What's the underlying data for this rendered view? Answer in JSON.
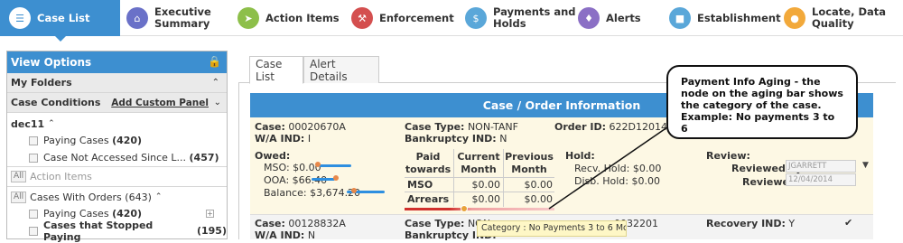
{
  "nav": {
    "items": [
      {
        "label": "Case List",
        "icon": "list-icon",
        "color": "#3d8fd0"
      },
      {
        "label": "Executive\nSummary",
        "icon": "home-icon",
        "color": "#6a71c8"
      },
      {
        "label": "Action Items",
        "icon": "arrow-icon",
        "color": "#8dbf4a"
      },
      {
        "label": "Enforcement",
        "icon": "gavel-icon",
        "color": "#d44f4f"
      },
      {
        "label": "Payments and\nHolds",
        "icon": "money-icon",
        "color": "#5aa7d9"
      },
      {
        "label": "Alerts",
        "icon": "bell-icon",
        "color": "#8b6fc5"
      },
      {
        "label": "Establishment",
        "icon": "briefcase-icon",
        "color": "#5aa7d9"
      },
      {
        "label": "Locate, Data\nQuality",
        "icon": "location-pin-icon",
        "color": "#f2a93b"
      }
    ]
  },
  "left": {
    "title": "View Options",
    "my_folders": "My Folders",
    "case_conditions": "Case Conditions",
    "add_custom_panel": "Add Custom Panel",
    "group1": "dec11",
    "items1": [
      {
        "label": "Paying Cases",
        "count": "(420)"
      },
      {
        "label": "Case Not Accessed Since L...",
        "count": "(457)"
      }
    ],
    "all_tag": "All",
    "action_items": "Action Items",
    "cases_with_orders": "Cases With Orders (643)",
    "items2": [
      {
        "label": "Paying Cases",
        "count": "(420)"
      },
      {
        "label": "Cases that Stopped Paying",
        "count": "(195)"
      }
    ]
  },
  "tabs": [
    "Case List",
    "Alert Details"
  ],
  "section_title": "Case / Order Information",
  "case1": {
    "case_label": "Case:",
    "case_value": "00020670A",
    "wa_label": "W/A IND:",
    "wa_value": "I",
    "type_label": "Case Type:",
    "type_value": "NON-TANF",
    "bank_label": "Bankruptcy IND:",
    "bank_value": "N",
    "order_label": "Order ID:",
    "order_value": "622D120140",
    "owed_label": "Owed:",
    "mso": "MSO: $0.00",
    "ooa": "OOA: $66.40",
    "balance": "Balance: $3,674.20",
    "table_headers": [
      "Paid towards",
      "Current Month",
      "Previous Month"
    ],
    "table_rows": [
      [
        "MSO",
        "$0.00",
        "$0.00"
      ],
      [
        "Arrears",
        "$0.00",
        "$0.00"
      ]
    ],
    "hold_label": "Hold:",
    "recv_hold": "Recv. Hold: $0.00",
    "disb_hold": "Disb. Hold: $0.00",
    "review_label": "Review:",
    "reviewed_by_label": "Reviewed by:",
    "reviewed_by_value": "JGARRETT",
    "reviewed_label": "Reviewed:",
    "reviewed_value": "12/04/2014",
    "aging_node_fraction": 0.4
  },
  "case2": {
    "case_label": "Case:",
    "case_value": "00128832A",
    "wa_label": "W/A IND:",
    "wa_value": "N",
    "type_label": "Case Type:",
    "type_value": "NON-",
    "bank_label": "Bankruptcy IND:",
    "order_fragment": "0032201",
    "recovery_label": "Recovery IND:",
    "recovery_value": "Y"
  },
  "tooltip": "Category : No Payments 3 to 6 Months",
  "callout": "Payment Info Aging - the node on the aging bar shows the category of the case. Example: No payments 3 to 6"
}
